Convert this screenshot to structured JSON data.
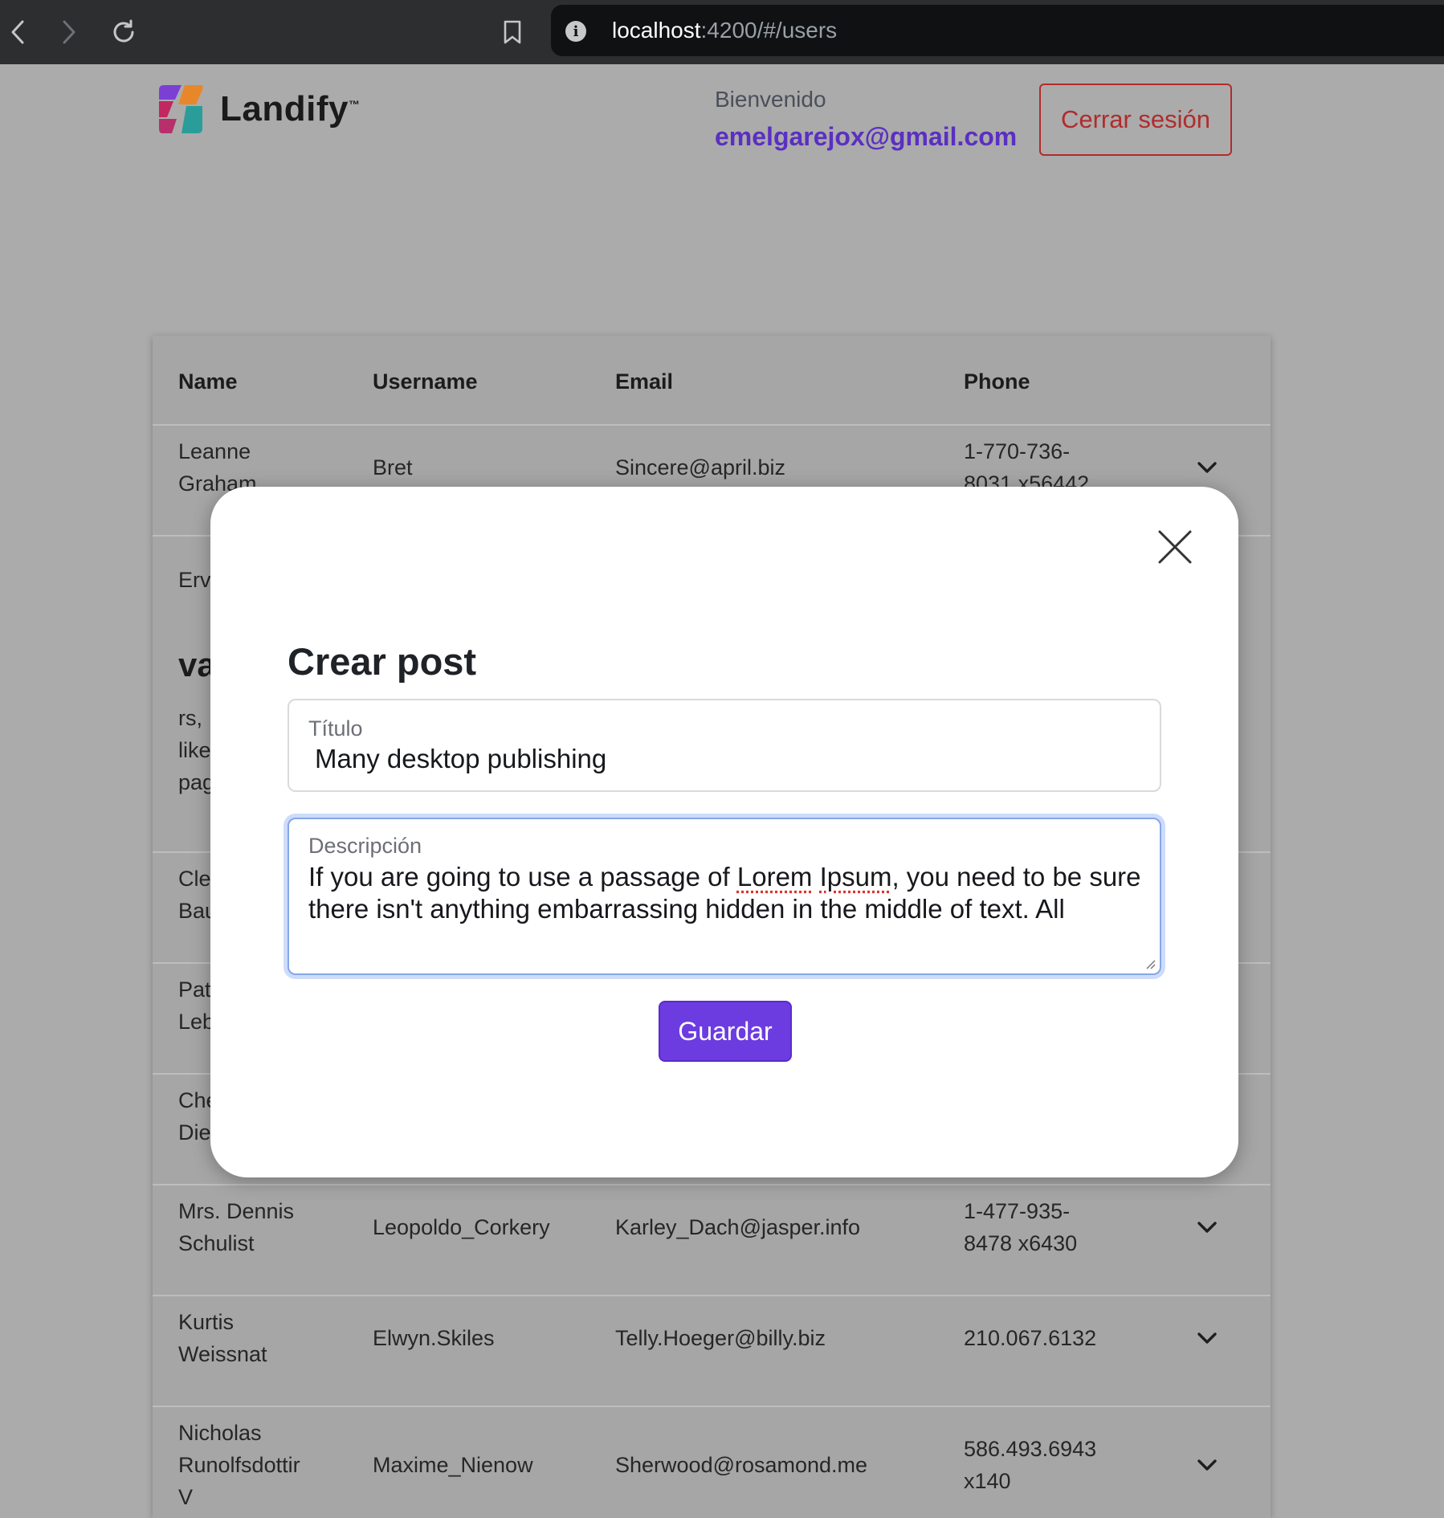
{
  "browser": {
    "url_host": "localhost",
    "url_path": ":4200/#/users"
  },
  "header": {
    "logo_text": "Landify",
    "logo_tm": "™",
    "welcome_label": "Bienvenido",
    "user_email": "emelgarejox@gmail.com",
    "logout_label": "Cerrar sesión"
  },
  "table": {
    "columns": [
      "Name",
      "Username",
      "Email",
      "Phone"
    ],
    "rows": [
      {
        "name": [
          "Leanne",
          "Graham"
        ],
        "username": "Bret",
        "email": "Sincere@april.biz",
        "phone": [
          "1-770-736-",
          "8031 x56442"
        ]
      },
      {
        "name": [
          "Erv"
        ]
      },
      {
        "name": [
          "Cle",
          "Bau"
        ]
      },
      {
        "name": [
          "Pat",
          "Leb"
        ]
      },
      {
        "name": [
          "Che",
          "Die"
        ]
      },
      {
        "name": [
          "Mrs. Dennis",
          "Schulist"
        ],
        "username": "Leopoldo_Corkery",
        "email": "Karley_Dach@jasper.info",
        "phone": [
          "1-477-935-",
          "8478 x6430"
        ]
      },
      {
        "name": [
          "Kurtis",
          "Weissnat"
        ],
        "username": "Elwyn.Skiles",
        "email": "Telly.Hoeger@billy.biz",
        "phone": [
          "210.067.6132"
        ]
      },
      {
        "name": [
          "Nicholas",
          "Runolfsdottir",
          "V"
        ],
        "username": "Maxime_Nienow",
        "email": "Sherwood@rosamond.me",
        "phone": [
          "586.493.6943",
          "x140"
        ]
      }
    ],
    "expanded_fragment": {
      "heading": "va",
      "lines": [
        "rs,",
        "like",
        "pag"
      ]
    }
  },
  "modal": {
    "title": "Crear post",
    "title_field": {
      "label": "Título",
      "value": "Many desktop publishing"
    },
    "description_field": {
      "label": "Descripción",
      "line1_pre": "If you are going to use a passage of ",
      "line1_word1": "Lorem",
      "line1_space": " ",
      "line1_word2": "Ipsum",
      "line1_post": ", you need to be sure",
      "line2": "there isn't anything embarrassing hidden in the middle of text. All"
    },
    "save_label": "Guardar"
  },
  "colors": {
    "accent": "#6c3ce0",
    "danger": "#b22b2b",
    "email_link": "#5b2fc2"
  }
}
